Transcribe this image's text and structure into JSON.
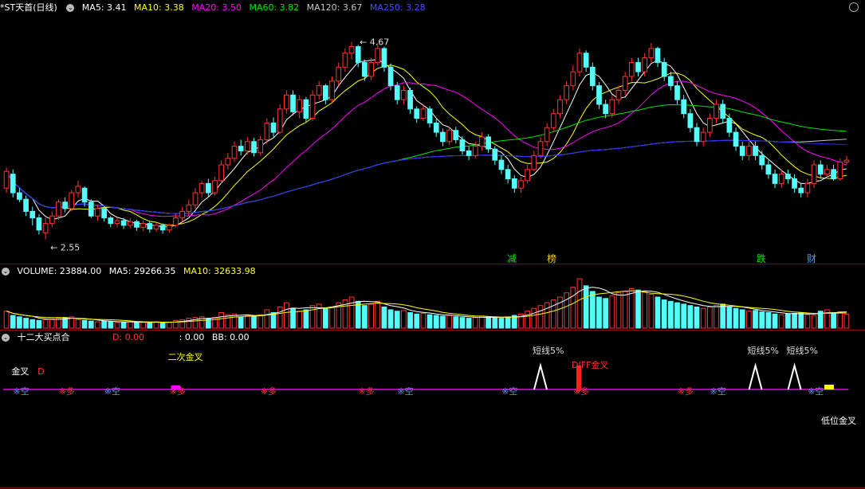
{
  "header": {
    "title": "*ST天首(日线)",
    "ma5": "MA5: 3.41",
    "ma10": "MA10: 3.38",
    "ma20": "MA20: 3.50",
    "ma60": "MA60: 3.82",
    "ma120": "MA120: 3.67",
    "ma250": "MA250: 3.28"
  },
  "volume_header": {
    "title": "VOLUME: 23884.00",
    "ma5": "MA5: 29266.35",
    "ma10": "MA10: 32633.98"
  },
  "indicator_header": {
    "title": "十二大买点合",
    "d": "D: 0.00",
    "c": ": 0.00",
    "bb": "BB: 0.00"
  },
  "colors": {
    "up": "#ff3232",
    "down": "#54fcfc",
    "ma5": "#ffffff",
    "ma10": "#ffff00",
    "ma20": "#ff00ff",
    "ma60": "#00e600",
    "ma120": "#c8c8c8",
    "ma250": "#2828ff",
    "grid": "#8b0000",
    "baseline": "#b000b0"
  },
  "chart_data": {
    "type": "candlestick",
    "high_label": "4.67",
    "low_label": "2.55",
    "y_range": [
      2.4,
      4.95
    ],
    "candles": [
      [
        3.1,
        3.28,
        3.32,
        3.05
      ],
      [
        3.25,
        3.05,
        3.3,
        3.0
      ],
      [
        3.05,
        2.98,
        3.1,
        2.95
      ],
      [
        2.98,
        2.85,
        3.02,
        2.8
      ],
      [
        2.85,
        2.78,
        2.9,
        2.7
      ],
      [
        2.78,
        2.65,
        2.82,
        2.6
      ],
      [
        2.62,
        2.72,
        2.78,
        2.55
      ],
      [
        2.72,
        2.8,
        2.85,
        2.68
      ],
      [
        2.8,
        2.95,
        2.98,
        2.76
      ],
      [
        2.95,
        2.88,
        3.0,
        2.84
      ],
      [
        2.88,
        3.05,
        3.08,
        2.85
      ],
      [
        3.05,
        3.12,
        3.18,
        3.0
      ],
      [
        3.1,
        2.95,
        3.12,
        2.9
      ],
      [
        2.95,
        2.8,
        2.98,
        2.78
      ],
      [
        2.8,
        2.88,
        2.92,
        2.75
      ],
      [
        2.88,
        2.78,
        2.9,
        2.74
      ],
      [
        2.78,
        2.72,
        2.8,
        2.68
      ],
      [
        2.72,
        2.75,
        2.78,
        2.68
      ],
      [
        2.75,
        2.7,
        2.78,
        2.66
      ],
      [
        2.7,
        2.74,
        2.78,
        2.67
      ],
      [
        2.74,
        2.68,
        2.76,
        2.64
      ],
      [
        2.68,
        2.72,
        2.75,
        2.64
      ],
      [
        2.72,
        2.66,
        2.74,
        2.62
      ],
      [
        2.66,
        2.7,
        2.73,
        2.63
      ],
      [
        2.7,
        2.65,
        2.72,
        2.61
      ],
      [
        2.65,
        2.7,
        2.72,
        2.62
      ],
      [
        2.7,
        2.78,
        2.82,
        2.68
      ],
      [
        2.78,
        2.85,
        2.9,
        2.74
      ],
      [
        2.85,
        2.92,
        2.98,
        2.8
      ],
      [
        2.92,
        3.05,
        3.1,
        2.88
      ],
      [
        3.05,
        3.15,
        3.18,
        3.0
      ],
      [
        3.15,
        3.05,
        3.2,
        3.0
      ],
      [
        3.05,
        3.18,
        3.22,
        3.02
      ],
      [
        3.18,
        3.35,
        3.4,
        3.15
      ],
      [
        3.35,
        3.42,
        3.48,
        3.3
      ],
      [
        3.42,
        3.55,
        3.6,
        3.38
      ],
      [
        3.55,
        3.5,
        3.62,
        3.45
      ],
      [
        3.5,
        3.6,
        3.65,
        3.46
      ],
      [
        3.6,
        3.48,
        3.64,
        3.44
      ],
      [
        3.48,
        3.62,
        3.66,
        3.45
      ],
      [
        3.62,
        3.8,
        3.85,
        3.58
      ],
      [
        3.8,
        3.7,
        3.86,
        3.65
      ],
      [
        3.7,
        3.95,
        4.0,
        3.68
      ],
      [
        3.95,
        4.1,
        4.15,
        3.9
      ],
      [
        4.1,
        3.92,
        4.15,
        3.88
      ],
      [
        3.92,
        4.05,
        4.1,
        3.85
      ],
      [
        4.05,
        3.85,
        4.08,
        3.8
      ],
      [
        3.85,
        4.1,
        4.15,
        3.82
      ],
      [
        4.1,
        4.2,
        4.25,
        4.05
      ],
      [
        4.2,
        4.05,
        4.22,
        4.0
      ],
      [
        4.05,
        4.25,
        4.3,
        4.02
      ],
      [
        4.25,
        4.4,
        4.45,
        4.2
      ],
      [
        4.4,
        4.55,
        4.6,
        4.35
      ],
      [
        4.55,
        4.62,
        4.67,
        4.48
      ],
      [
        4.62,
        4.45,
        4.64,
        4.4
      ],
      [
        4.45,
        4.3,
        4.48,
        4.25
      ],
      [
        4.3,
        4.45,
        4.5,
        4.26
      ],
      [
        4.45,
        4.6,
        4.66,
        4.42
      ],
      [
        4.6,
        4.4,
        4.62,
        4.35
      ],
      [
        4.4,
        4.2,
        4.44,
        4.15
      ],
      [
        4.2,
        4.05,
        4.24,
        4.0
      ],
      [
        4.05,
        4.15,
        4.2,
        4.0
      ],
      [
        4.15,
        3.95,
        4.18,
        3.9
      ],
      [
        3.95,
        3.85,
        3.98,
        3.8
      ],
      [
        3.85,
        3.95,
        4.0,
        3.82
      ],
      [
        3.95,
        3.8,
        3.98,
        3.75
      ],
      [
        3.8,
        3.7,
        3.84,
        3.65
      ],
      [
        3.7,
        3.6,
        3.74,
        3.55
      ],
      [
        3.6,
        3.72,
        3.76,
        3.56
      ],
      [
        3.72,
        3.62,
        3.76,
        3.58
      ],
      [
        3.62,
        3.5,
        3.66,
        3.46
      ],
      [
        3.5,
        3.45,
        3.55,
        3.4
      ],
      [
        3.45,
        3.55,
        3.6,
        3.42
      ],
      [
        3.55,
        3.65,
        3.7,
        3.5
      ],
      [
        3.65,
        3.52,
        3.68,
        3.48
      ],
      [
        3.52,
        3.4,
        3.55,
        3.35
      ],
      [
        3.4,
        3.3,
        3.45,
        3.25
      ],
      [
        3.3,
        3.2,
        3.35,
        3.15
      ],
      [
        3.2,
        3.1,
        3.24,
        3.05
      ],
      [
        3.1,
        3.18,
        3.22,
        3.05
      ],
      [
        3.18,
        3.3,
        3.35,
        3.15
      ],
      [
        3.3,
        3.45,
        3.5,
        3.28
      ],
      [
        3.45,
        3.6,
        3.65,
        3.42
      ],
      [
        3.6,
        3.75,
        3.8,
        3.55
      ],
      [
        3.75,
        3.9,
        3.95,
        3.7
      ],
      [
        3.9,
        4.05,
        4.1,
        3.85
      ],
      [
        4.05,
        4.2,
        4.25,
        4.0
      ],
      [
        4.2,
        4.35,
        4.42,
        4.15
      ],
      [
        4.35,
        4.55,
        4.6,
        4.3
      ],
      [
        4.55,
        4.4,
        4.58,
        4.35
      ],
      [
        4.4,
        4.2,
        4.45,
        4.15
      ],
      [
        4.2,
        4.0,
        4.24,
        3.95
      ],
      [
        4.0,
        3.9,
        4.05,
        3.85
      ],
      [
        3.9,
        4.05,
        4.1,
        3.86
      ],
      [
        4.05,
        4.15,
        4.2,
        4.0
      ],
      [
        4.15,
        4.3,
        4.35,
        4.1
      ],
      [
        4.3,
        4.45,
        4.5,
        4.25
      ],
      [
        4.45,
        4.35,
        4.5,
        4.3
      ],
      [
        4.35,
        4.5,
        4.55,
        4.3
      ],
      [
        4.5,
        4.6,
        4.66,
        4.45
      ],
      [
        4.6,
        4.45,
        4.62,
        4.4
      ],
      [
        4.45,
        4.3,
        4.5,
        4.25
      ],
      [
        4.3,
        4.2,
        4.35,
        4.15
      ],
      [
        4.2,
        4.05,
        4.25,
        4.0
      ],
      [
        4.05,
        3.9,
        4.1,
        3.85
      ],
      [
        3.9,
        3.75,
        3.95,
        3.7
      ],
      [
        3.75,
        3.6,
        3.8,
        3.55
      ],
      [
        3.6,
        3.7,
        3.75,
        3.55
      ],
      [
        3.7,
        3.85,
        3.9,
        3.65
      ],
      [
        3.85,
        4.0,
        4.05,
        3.8
      ],
      [
        4.0,
        3.85,
        4.05,
        3.8
      ],
      [
        3.85,
        3.7,
        3.9,
        3.65
      ],
      [
        3.7,
        3.55,
        3.75,
        3.5
      ],
      [
        3.55,
        3.45,
        3.6,
        3.4
      ],
      [
        3.45,
        3.55,
        3.6,
        3.4
      ],
      [
        3.55,
        3.45,
        3.6,
        3.4
      ],
      [
        3.45,
        3.35,
        3.5,
        3.3
      ],
      [
        3.35,
        3.25,
        3.4,
        3.2
      ],
      [
        3.25,
        3.15,
        3.3,
        3.1
      ],
      [
        3.15,
        3.25,
        3.3,
        3.1
      ],
      [
        3.25,
        3.2,
        3.3,
        3.15
      ],
      [
        3.2,
        3.1,
        3.25,
        3.05
      ],
      [
        3.1,
        3.05,
        3.15,
        3.0
      ],
      [
        3.05,
        3.15,
        3.2,
        3.0
      ],
      [
        3.15,
        3.35,
        3.4,
        3.1
      ],
      [
        3.35,
        3.25,
        3.4,
        3.2
      ],
      [
        3.25,
        3.3,
        3.35,
        3.2
      ],
      [
        3.3,
        3.2,
        3.35,
        3.18
      ],
      [
        3.2,
        3.38,
        3.42,
        3.18
      ],
      [
        3.38,
        3.4,
        3.45,
        3.35
      ]
    ],
    "volumes": [
      120,
      90,
      80,
      70,
      60,
      55,
      60,
      65,
      70,
      75,
      80,
      60,
      55,
      50,
      45,
      50,
      45,
      40,
      42,
      45,
      40,
      42,
      40,
      44,
      38,
      42,
      55,
      60,
      70,
      75,
      80,
      65,
      75,
      110,
      95,
      100,
      80,
      90,
      85,
      95,
      130,
      110,
      150,
      180,
      140,
      120,
      130,
      160,
      170,
      140,
      150,
      180,
      200,
      220,
      190,
      160,
      170,
      190,
      150,
      130,
      120,
      125,
      110,
      100,
      105,
      95,
      90,
      85,
      90,
      80,
      75,
      70,
      75,
      85,
      80,
      75,
      70,
      80,
      90,
      100,
      120,
      140,
      160,
      180,
      200,
      220,
      250,
      290,
      350,
      300,
      260,
      220,
      210,
      230,
      250,
      260,
      280,
      270,
      260,
      240,
      220,
      200,
      190,
      180,
      170,
      160,
      150,
      140,
      150,
      160,
      170,
      150,
      140,
      130,
      120,
      125,
      115,
      110,
      100,
      95,
      100,
      105,
      110,
      95,
      90,
      120,
      130,
      110,
      115,
      100,
      95,
      105
    ],
    "labels_top": [
      "减",
      "榜",
      "跌",
      "财"
    ],
    "signals": [
      {
        "type": "text",
        "text": "金叉",
        "i": 2
      },
      {
        "type": "text",
        "text": "D",
        "i": 6
      },
      {
        "type": "text",
        "text": "二次金叉",
        "i": 26
      },
      {
        "type": "text",
        "text": "短线5%",
        "i": 82
      },
      {
        "type": "text",
        "text": "DIFF金叉",
        "i": 88
      },
      {
        "type": "text",
        "text": "短线5%",
        "i": 115
      },
      {
        "type": "text",
        "text": "短线5%",
        "i": 121
      },
      {
        "type": "text",
        "text": "低位金叉",
        "i": 133
      }
    ],
    "ma_markers": [
      {
        "text": "※空",
        "i": 2,
        "up": false
      },
      {
        "text": "※多",
        "i": 9,
        "up": true
      },
      {
        "text": "※空",
        "i": 16,
        "up": false
      },
      {
        "text": "※多",
        "i": 26,
        "up": true
      },
      {
        "text": "※多",
        "i": 40,
        "up": true
      },
      {
        "text": "※多",
        "i": 55,
        "up": true
      },
      {
        "text": "※空",
        "i": 61,
        "up": false
      },
      {
        "text": "※空",
        "i": 77,
        "up": false
      },
      {
        "text": "※多",
        "i": 88,
        "up": true
      },
      {
        "text": "※多",
        "i": 104,
        "up": true
      },
      {
        "text": "※空",
        "i": 109,
        "up": false
      },
      {
        "text": "※空",
        "i": 124,
        "up": false
      },
      {
        "text": "※多",
        "i": 134,
        "up": true
      }
    ]
  }
}
